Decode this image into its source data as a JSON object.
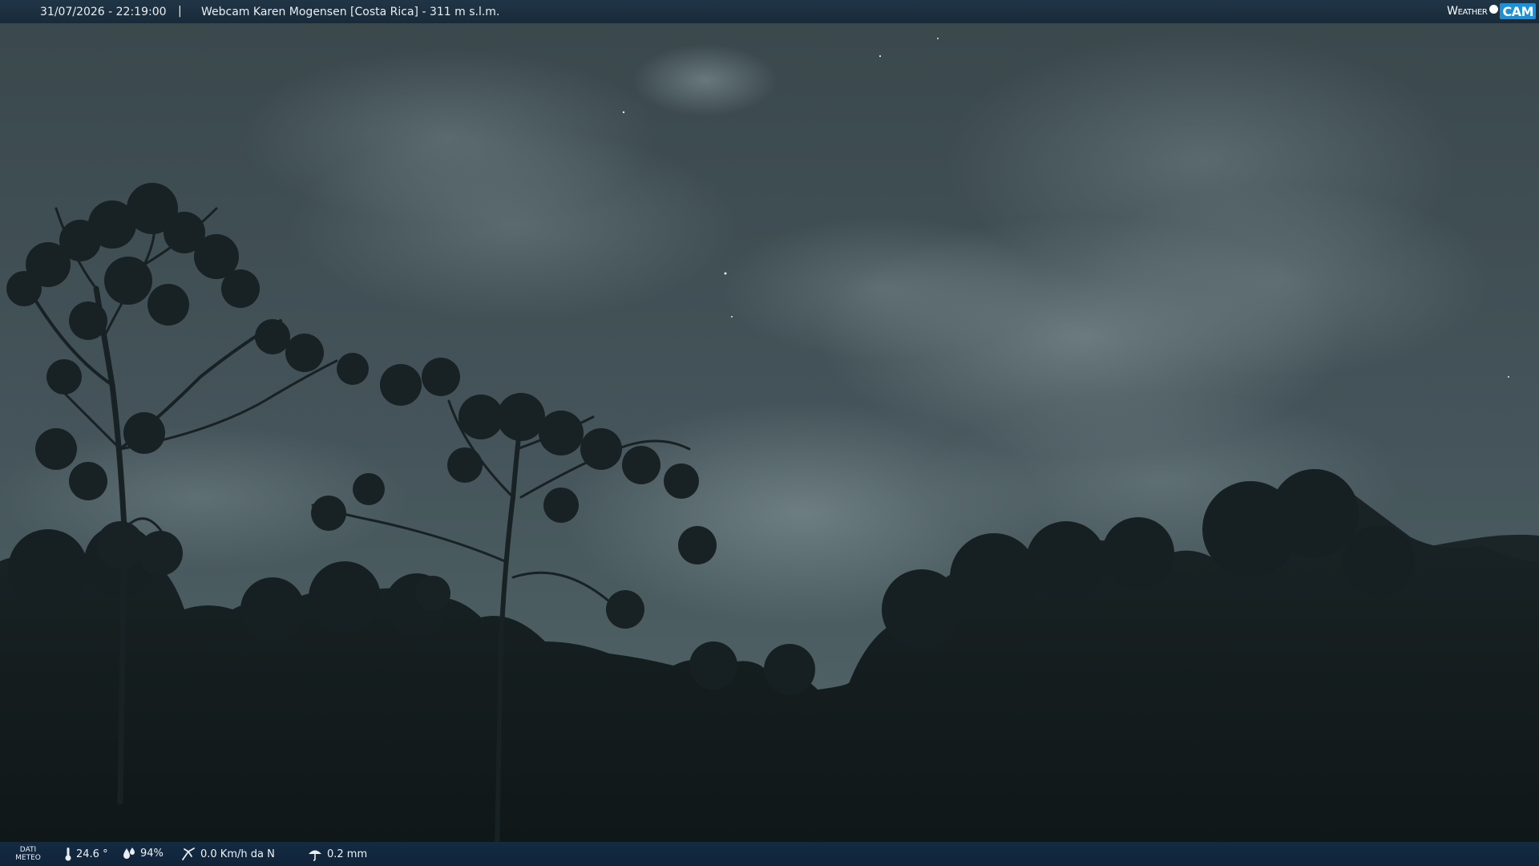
{
  "header": {
    "datetime": "31/07/2026 - 22:19:00",
    "separator": "|",
    "title": "Webcam Karen Mogensen [Costa Rica]  - 311 m s.l.m."
  },
  "logo": {
    "weather": "Weather",
    "cam": "CAM"
  },
  "footer": {
    "meteo_label_line1": "DATI",
    "meteo_label_line2": "METEO",
    "temperature": "24.6 °",
    "humidity": "94%",
    "wind": "0.0 Km/h da N",
    "rain": "0.2 mm"
  },
  "icons": {
    "temperature": "thermometer-icon",
    "humidity": "water-drops-icon",
    "wind": "wind-icon",
    "rain": "umbrella-icon"
  },
  "colors": {
    "sky": "#3b4a4f",
    "foliage": "#141d1e",
    "bar": "#1e3446",
    "logo_accent": "#1f8fd6"
  }
}
